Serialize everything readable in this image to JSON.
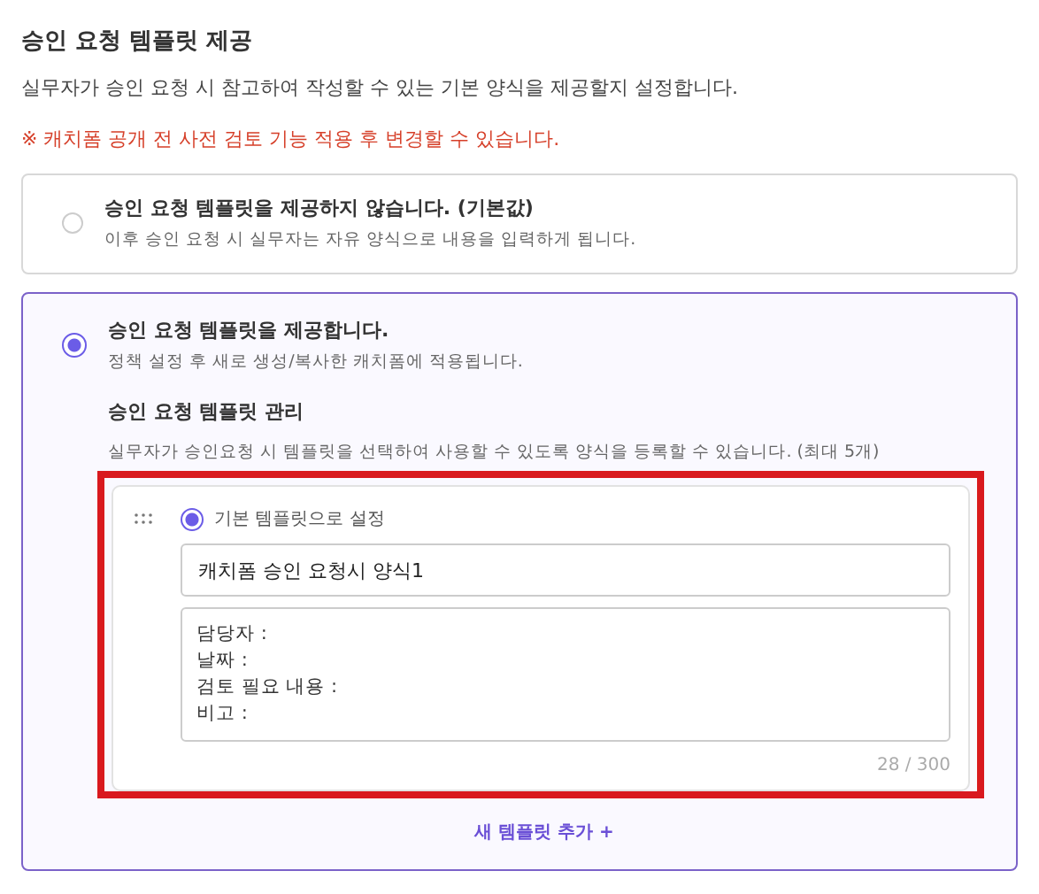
{
  "section": {
    "title": "승인 요청 템플릿 제공",
    "description": "실무자가 승인 요청 시 참고하여 작성할 수 있는 기본 양식을 제공할지 설정합니다.",
    "notice": "※ 캐치폼 공개 전 사전 검토 기능 적용 후 변경할 수 있습니다."
  },
  "options": [
    {
      "title": "승인 요청 템플릿을 제공하지 않습니다. (기본값)",
      "description": "이후 승인 요청 시 실무자는 자유 양식으로 내용을 입력하게 됩니다.",
      "selected": false
    },
    {
      "title": "승인 요청 템플릿을 제공합니다.",
      "description": "정책 설정 후 새로 생성/복사한 캐치폼에 적용됩니다.",
      "selected": true,
      "template_manager": {
        "title": "승인 요청 템플릿 관리",
        "description": "실무자가 승인요청 시 템플릿을 선택하여 사용할 수 있도록 양식을 등록할 수 있습니다. (최대 5개)",
        "templates": [
          {
            "highlighted": true,
            "default": true,
            "default_label": "기본 템플릿으로 설정",
            "name": "캐치폼 승인 요청시 양식1",
            "body": "담당자 :\n날짜 :\n검토 필요 내용 :\n비고 :",
            "counter": "28 / 300"
          }
        ],
        "add_button": "새 템플릿 추가 +"
      }
    }
  ]
}
